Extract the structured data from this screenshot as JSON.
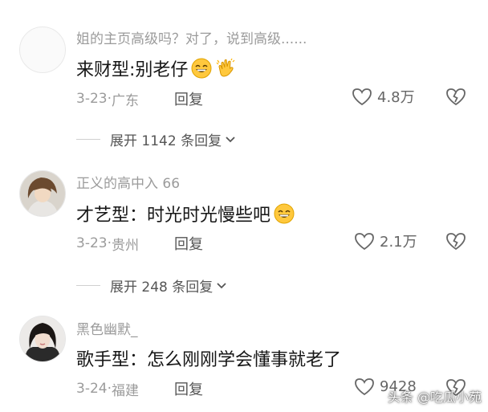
{
  "comments": [
    {
      "username": "姐的主页高级吗？对了，说到高级......",
      "text": "来财型:别老仔",
      "emojis": [
        "grin-emoji",
        "clap-emoji"
      ],
      "date": "3-23",
      "location": "广东",
      "reply_label": "回复",
      "likes": "4.8万"
    },
    {
      "username": "正义的高中入 66",
      "text": "才艺型：时光时光慢些吧",
      "emojis": [
        "grin-emoji"
      ],
      "date": "3-23",
      "location": "贵州",
      "reply_label": "回复",
      "likes": "2.1万"
    },
    {
      "username": "黑色幽默_",
      "text": "歌手型：怎么刚刚学会懂事就老了",
      "emojis": [],
      "date": "3-24",
      "location": "福建",
      "reply_label": "回复",
      "likes": "9428"
    }
  ],
  "expanders": [
    {
      "label": "展开 1142 条回复"
    },
    {
      "label": "展开 248 条回复"
    }
  ],
  "watermark": "头条 @吃瓜小苑",
  "colors": {
    "muted_text": "#9b9b9b",
    "body_text": "#161616",
    "emoji_yellow": "#ffc83d"
  }
}
